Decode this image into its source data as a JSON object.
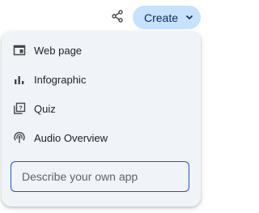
{
  "header": {
    "share_icon": "share-icon",
    "create_label": "Create",
    "create_icon": "chevron-down-icon"
  },
  "menu": {
    "items": [
      {
        "label": "Web page",
        "icon": "web-page-icon"
      },
      {
        "label": "Infographic",
        "icon": "bar-chart-icon"
      },
      {
        "label": "Quiz",
        "icon": "quiz-icon"
      },
      {
        "label": "Audio Overview",
        "icon": "podcast-icon"
      }
    ],
    "describe_placeholder": "Describe your own app",
    "describe_value": ""
  },
  "colors": {
    "create_bg": "#c6e2ff",
    "menu_bg": "#f0f4f9",
    "input_border": "#1a57c9"
  }
}
